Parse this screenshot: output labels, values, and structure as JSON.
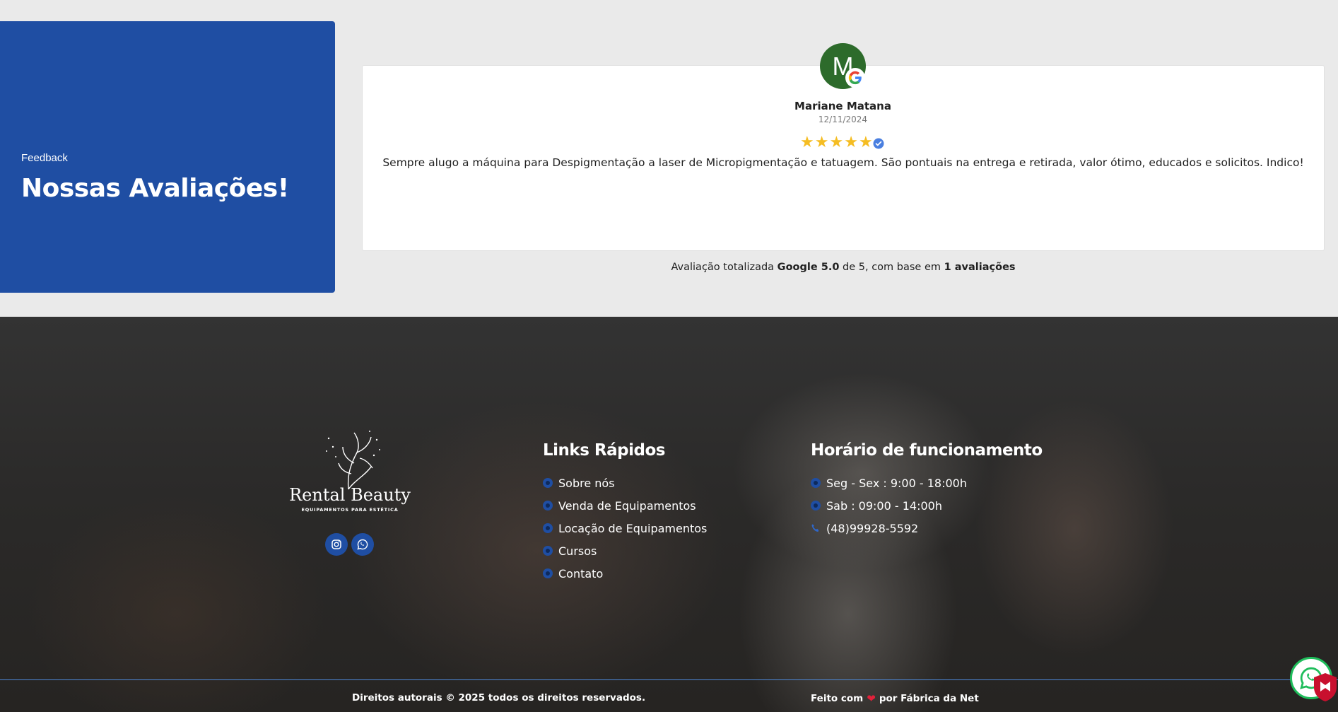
{
  "reviews": {
    "kicker": "Feedback",
    "title": "Nossas Avaliações!",
    "review": {
      "avatar_letter": "M",
      "name": "Mariane Matana",
      "date": "12/11/2024",
      "rating": 5,
      "text": "Sempre alugo a máquina para Despigmentação a laser de Micropigmentação e tatuagem. São pontuais na entrega e retirada, valor ótimo, educados e solicitos. Indico!"
    },
    "summary": {
      "prefix": "Avaliação totalizada",
      "score": "Google 5.0",
      "middle": "de 5, com base em",
      "count": "1 avaliações"
    }
  },
  "footer": {
    "logo": {
      "name": "Rental Beauty",
      "tagline": "EQUIPAMENTOS PARA ESTÉTICA"
    },
    "social": [
      "instagram-icon",
      "whatsapp-icon"
    ],
    "links_title": "Links Rápidos",
    "links": [
      "Sobre nós",
      "Venda de Equipamentos",
      "Locação de Equipamentos",
      "Cursos",
      "Contato"
    ],
    "hours_title": "Horário de funcionamento",
    "hours": [
      "Seg - Sex : 9:00 - 18:00h",
      "Sab : 09:00 - 14:00h"
    ],
    "phone": "(48)99928-5592",
    "copyright": "Direitos autorais © 2025 todos os direitos reservados.",
    "made_prefix": "Feito com",
    "made_suffix": "por Fábrica da Net"
  },
  "colors": {
    "brand_blue": "#1f4ea3",
    "star": "#f5bd23",
    "avatar_bg": "#2d6b2b",
    "whatsapp_green": "#1fbd5b",
    "shield_red": "#c8102e"
  }
}
